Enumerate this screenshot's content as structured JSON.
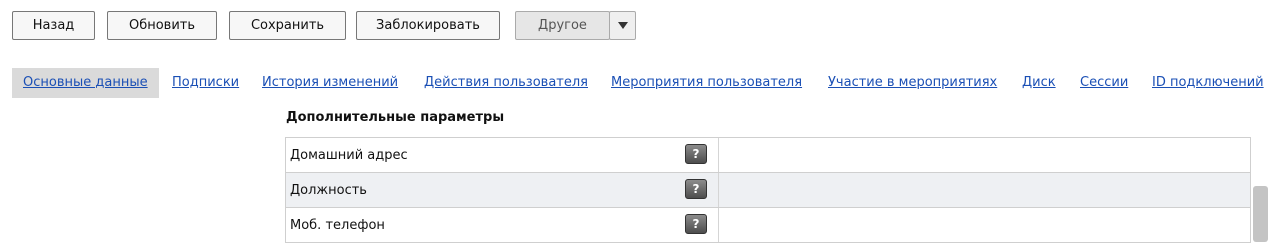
{
  "toolbar": {
    "back": "Назад",
    "refresh": "Обновить",
    "save": "Сохранить",
    "block": "Заблокировать",
    "other": "Другое"
  },
  "tabs": [
    {
      "label": "Основные данные",
      "active": true
    },
    {
      "label": "Подписки"
    },
    {
      "label": "История изменений"
    },
    {
      "label": "Действия пользователя"
    },
    {
      "label": "Мероприятия пользователя"
    },
    {
      "label": "Участие в мероприятиях"
    },
    {
      "label": "Диск"
    },
    {
      "label": "Сессии"
    },
    {
      "label": "ID подключений"
    }
  ],
  "section": {
    "title": "Дополнительные параметры",
    "rows": [
      {
        "label": "Домашний адрес",
        "help": "?",
        "value": ""
      },
      {
        "label": "Должность",
        "help": "?",
        "value": ""
      },
      {
        "label": "Моб. телефон",
        "help": "?",
        "value": ""
      }
    ]
  }
}
